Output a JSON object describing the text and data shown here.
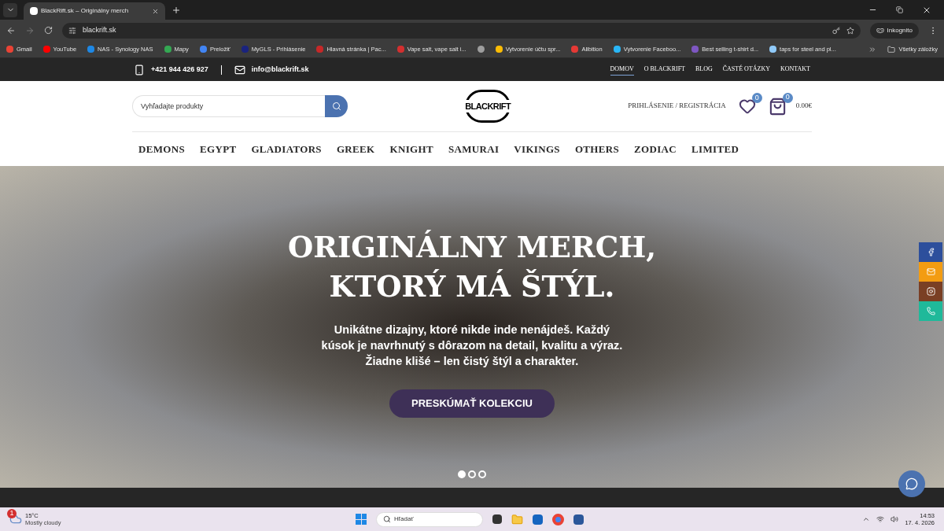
{
  "browser": {
    "tab_title": "BlackRift.sk – Originálny merch",
    "url": "blackrift.sk",
    "incognito_label": "Inkognito",
    "bookmarks": [
      {
        "label": "Gmail",
        "color": "#ea4335"
      },
      {
        "label": "YouTube",
        "color": "#ff0000"
      },
      {
        "label": "NAS - Synology NAS",
        "color": "#1e88e5"
      },
      {
        "label": "Mapy",
        "color": "#34a853"
      },
      {
        "label": "Preložiť",
        "color": "#4285f4"
      },
      {
        "label": "MyGLS - Prihlásenie",
        "color": "#1a237e"
      },
      {
        "label": "Hlavná stránka | Pac...",
        "color": "#c62828"
      },
      {
        "label": "Vape salt, vape salt i...",
        "color": "#d32f2f"
      },
      {
        "color": "#9e9e9e"
      },
      {
        "label": "Vytvorenie účtu spr...",
        "color": "#fbbc05"
      },
      {
        "label": "Alibition",
        "color": "#e53935"
      },
      {
        "label": "Vytvorenie Faceboo...",
        "color": "#29b6f6"
      },
      {
        "label": "Best selling t-shirt d...",
        "color": "#7e57c2"
      },
      {
        "label": "taps for steel and pl...",
        "color": "#90caf9"
      }
    ],
    "all_bookmarks": "Všetky záložky"
  },
  "topbar": {
    "phone": "+421 944 426 927",
    "email": "info@blackrift.sk",
    "links": [
      {
        "label": "DOMOV",
        "selected": true
      },
      {
        "label": "O BLACKRIFT",
        "selected": false
      },
      {
        "label": "BLOG",
        "selected": false
      },
      {
        "label": "ČASTÉ OTÁZKY",
        "selected": false
      },
      {
        "label": "KONTAKT",
        "selected": false
      }
    ]
  },
  "header": {
    "search": {
      "placeholder": "Vyhľadajte produkty"
    },
    "logo": "BLACKRIFT",
    "login": "PRIHLÁSENIE / REGISTRÁCIA",
    "wishlist_count": "0",
    "cart_count": "0",
    "cart_total": "0.00€"
  },
  "categories": [
    "DEMONS",
    "EGYPT",
    "GLADIATORS",
    "GREEK",
    "KNIGHT",
    "SAMURAI",
    "VIKINGS",
    "OTHERS",
    "ZODIAC",
    "LIMITED"
  ],
  "hero": {
    "title_line_1": "ORIGINÁLNY MERCH,",
    "title_line_2": "KTORÝ MÁ ŠTÝL.",
    "text": "Unikátne dizajny, ktoré nikde inde nenájdeš. Každý kúsok je navrhnutý s dôrazom na detail, kvalitu a výraz. Žiadne klišé – len čistý štýl a charakter.",
    "button": "PRESKÚMAŤ KOLEKCIU",
    "slides": [
      {
        "selected": true
      },
      {
        "selected": false
      },
      {
        "selected": false
      }
    ]
  },
  "social": [
    {
      "kind": "facebook",
      "color": "#2d4f9c"
    },
    {
      "kind": "email",
      "color": "#f39c12"
    },
    {
      "kind": "instagram",
      "color": "#7a3f24"
    },
    {
      "kind": "whatsapp",
      "color": "#1fb99a"
    }
  ],
  "taskbar": {
    "temperature": "15°C",
    "weather": "Mostly cloudy",
    "weather_alert": "1",
    "search_placeholder": "Hľadať",
    "time": "14:53",
    "date": "17. 4. 2026"
  }
}
